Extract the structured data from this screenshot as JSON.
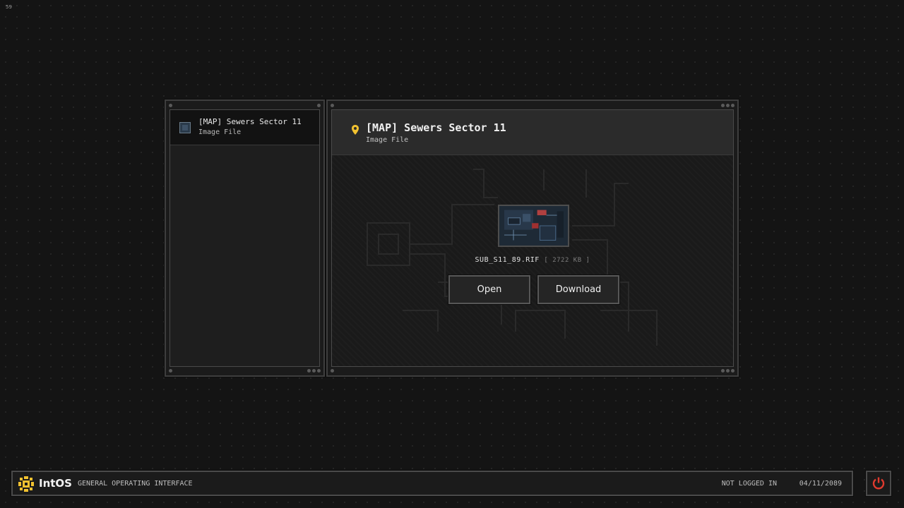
{
  "fps": "59",
  "sidebar": {
    "items": [
      {
        "title": "[MAP] Sewers Sector 11",
        "subtitle": "Image File"
      }
    ]
  },
  "viewer": {
    "title": "[MAP] Sewers Sector 11",
    "subtitle": "Image File",
    "filename": "SUB_S11_89.RIF",
    "filesize": "[ 2722 KB ]",
    "open_label": "Open",
    "download_label": "Download"
  },
  "taskbar": {
    "brand": "IntOS",
    "tagline": "GENERAL OPERATING INTERFACE",
    "login_status": "NOT LOGGED IN",
    "date": "04/11/2089"
  },
  "icons": {
    "pin": "location-pin-icon",
    "logo": "intos-logo-icon",
    "power": "power-icon",
    "file": "image-file-icon"
  },
  "colors": {
    "accent_yellow": "#f2c230",
    "power_red": "#e03a2e",
    "background": "#141414"
  }
}
